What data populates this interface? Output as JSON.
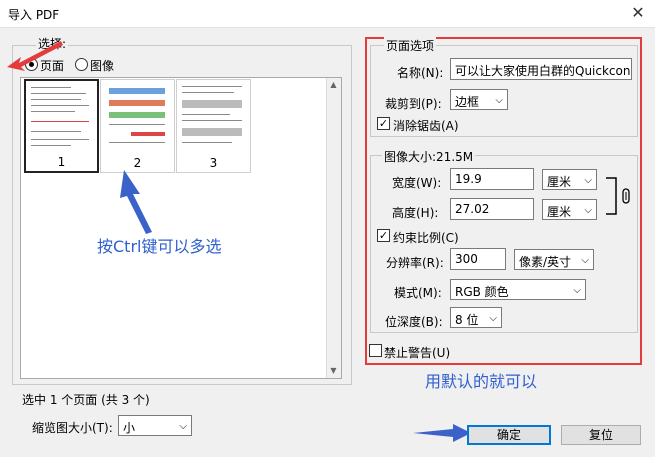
{
  "window": {
    "title": "导入 PDF",
    "close_glyph": "✕"
  },
  "selection": {
    "legend": "选择:",
    "page_label": "页面",
    "image_label": "图像",
    "thumbnails": [
      {
        "number": "1"
      },
      {
        "number": "2"
      },
      {
        "number": "3"
      }
    ],
    "annotation": "按Ctrl键可以多选",
    "status": "选中 1 个页面 (共 3 个)",
    "thumb_size_label": "缩览图大小(T):",
    "thumb_size_value": "小"
  },
  "page_options": {
    "legend": "页面选项",
    "name_label": "名称(N):",
    "name_value": "可以让大家使用白群的Quickconnect",
    "crop_label": "裁剪到(P):",
    "crop_value": "边框",
    "antialias_label": "消除锯齿(A)"
  },
  "image_size": {
    "legend": "图像大小:21.5M",
    "width_label": "宽度(W):",
    "width_value": "19.9",
    "width_unit": "厘米",
    "height_label": "高度(H):",
    "height_value": "27.02",
    "height_unit": "厘米",
    "constrain_label": "约束比例(C)",
    "resolution_label": "分辨率(R):",
    "resolution_value": "300",
    "resolution_unit": "像素/英寸",
    "mode_label": "模式(M):",
    "mode_value": "RGB 颜色",
    "depth_label": "位深度(B):",
    "depth_value": "8 位"
  },
  "suppress_warnings_label": "禁止警告(U)",
  "annotation_right": "用默认的就可以",
  "buttons": {
    "ok": "确定",
    "reset": "复位"
  },
  "colors": {
    "annotation_red": "#e43c3c",
    "annotation_blue": "#3060d0"
  }
}
